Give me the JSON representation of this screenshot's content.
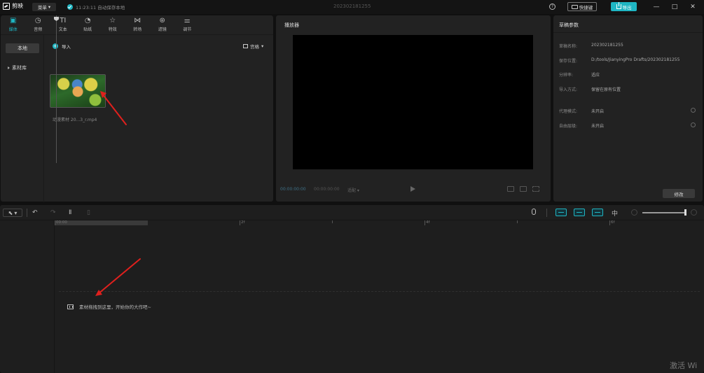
{
  "app": {
    "logo_text": "剪映",
    "menu_label": "菜单",
    "autosave_text": "11:23:11 自动保存本地",
    "doc_title": "202302181255",
    "shortcut_label": "快捷键",
    "export_label": "导出",
    "window_controls": [
      "—",
      "□",
      "✕"
    ]
  },
  "media": {
    "tabs": [
      {
        "label": "媒体",
        "icon": "media-icon",
        "glyph": "▣"
      },
      {
        "label": "音频",
        "icon": "audio-icon",
        "glyph": "◷"
      },
      {
        "label": "文本",
        "icon": "text-icon",
        "glyph": "TI"
      },
      {
        "label": "贴纸",
        "icon": "sticker-icon",
        "glyph": "◔"
      },
      {
        "label": "特效",
        "icon": "effects-icon",
        "glyph": "☆"
      },
      {
        "label": "转场",
        "icon": "transition-icon",
        "glyph": "⋈"
      },
      {
        "label": "滤镜",
        "icon": "filter-icon",
        "glyph": "⊛"
      },
      {
        "label": "调节",
        "icon": "adjust-icon",
        "glyph": "⚌"
      }
    ],
    "sidebar": {
      "local": "本地",
      "library": "素材库"
    },
    "import_label": "导入",
    "sort_label": "宫格",
    "file_name": "动漫素材 20...3_r.mp4"
  },
  "player": {
    "title": "播放器",
    "time_current": "00:00:00:00",
    "time_total": "00:00:00:00",
    "ratio_label": "适配"
  },
  "draft": {
    "title": "草稿参数",
    "rows": [
      {
        "key": "草稿名称:",
        "value": "202302181255"
      },
      {
        "key": "保存位置:",
        "value": "D:/tools/JianyingPro Drafts/202302181255"
      },
      {
        "key": "分辨率:",
        "value": "适应"
      },
      {
        "key": "导入方式:",
        "value": "保留在原有位置"
      },
      {
        "key": "代理模式:",
        "value": "未开启"
      },
      {
        "key": "自由层级:",
        "value": "未开启"
      }
    ],
    "modify_label": "修改"
  },
  "timeline": {
    "ruler_labels": [
      "00:00",
      "2f",
      "4f",
      "6f"
    ],
    "drop_hint": "素材拖拽到这里，开始你的大作吧~"
  },
  "watermark": "激活 Wi",
  "colors": {
    "accent": "#1fb6c3",
    "annotation": "#e0201d"
  }
}
